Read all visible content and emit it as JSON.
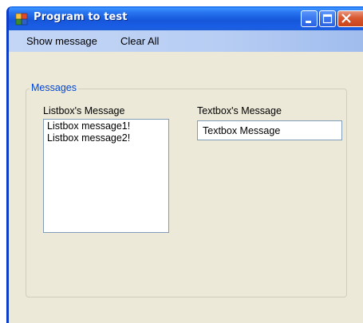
{
  "window": {
    "title": "Program to test",
    "icon": "app-window-icon",
    "controls": [
      "minimize-icon",
      "maximize-icon",
      "close-icon"
    ]
  },
  "menu": {
    "items": [
      {
        "label": "Show message"
      },
      {
        "label": "Clear All"
      }
    ]
  },
  "group": {
    "legend": "Messages",
    "listbox_label": "Listbox's Message",
    "listbox_items": [
      "Listbox message1!",
      "Listbox message2!"
    ],
    "textbox_label": "Textbox's Message",
    "textbox_value": "Textbox Message"
  },
  "colors": {
    "titlebar": "#1D5FD9",
    "window_background": "#ECE9D8",
    "menubar": "#B7CDF3",
    "group_legend": "#0046D5",
    "control_border": "#7F9DB9"
  }
}
